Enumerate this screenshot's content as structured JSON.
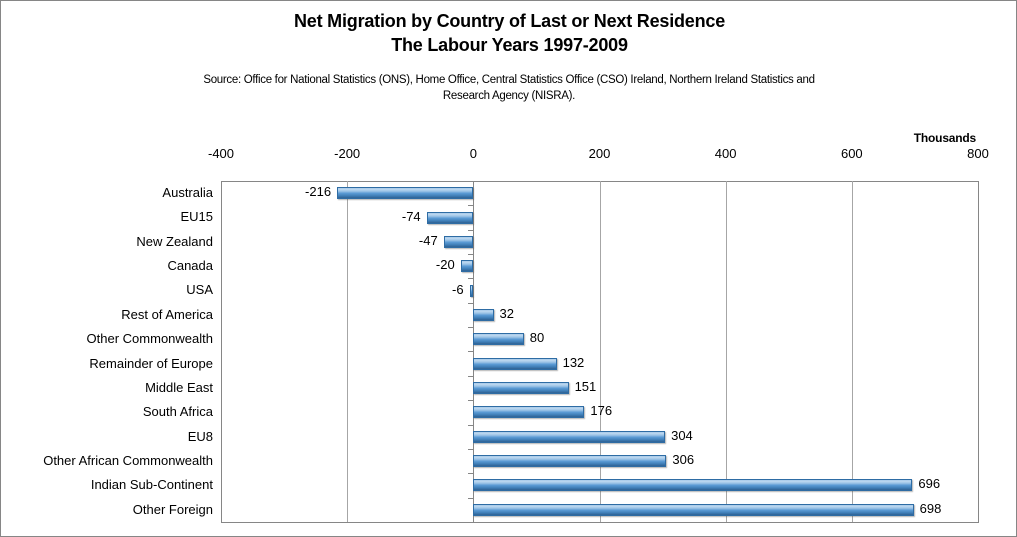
{
  "titles": {
    "line1": "Net Migration by Country of Last or Next Residence",
    "line2": "The Labour Years 1997-2009",
    "source": "Source: Office for National Statistics (ONS), Home Office, Central Statistics Office (CSO) Ireland, Northern Ireland Statistics and Research Agency (NISRA)."
  },
  "units_label": "Thousands",
  "colors": {
    "bar_light": "#bcd8f0",
    "bar_mid": "#5b9bd5",
    "bar_dark": "#2f6293",
    "bar_border": "#2e6ca4",
    "gridline": "#a6a6a6",
    "axis": "#868686",
    "text": "#000000",
    "background": "#ffffff"
  },
  "chart_data": {
    "type": "bar",
    "orientation": "horizontal",
    "title": "Net Migration by Country of Last or Next Residence / The Labour Years 1997-2009",
    "subtitle": "Source: Office for National Statistics (ONS), Home Office, Central Statistics Office (CSO) Ireland, Northern Ireland Statistics and Research Agency (NISRA).",
    "xlabel": "Thousands",
    "ylabel": "",
    "xlim": [
      -400,
      800
    ],
    "xticks": [
      -400,
      -200,
      0,
      200,
      400,
      600,
      800
    ],
    "xtick_labels": [
      "-400",
      "-200",
      "0",
      "200",
      "400",
      "600",
      "800"
    ],
    "grid": true,
    "legend": false,
    "categories": [
      "Australia",
      "EU15",
      "New Zealand",
      "Canada",
      "USA",
      "Rest of America",
      "Other Commonwealth",
      "Remainder of Europe",
      "Middle East",
      "South Africa",
      "EU8",
      "Other African Commonwealth",
      "Indian Sub-Continent",
      "Other Foreign"
    ],
    "values": [
      -216,
      -74,
      -47,
      -20,
      -6,
      32,
      80,
      132,
      151,
      176,
      304,
      306,
      696,
      698
    ],
    "data_labels": [
      "-216",
      "-74",
      "-47",
      "-20",
      "-6",
      "32",
      "80",
      "132",
      "151",
      "176",
      "304",
      "306",
      "696",
      "698"
    ]
  }
}
